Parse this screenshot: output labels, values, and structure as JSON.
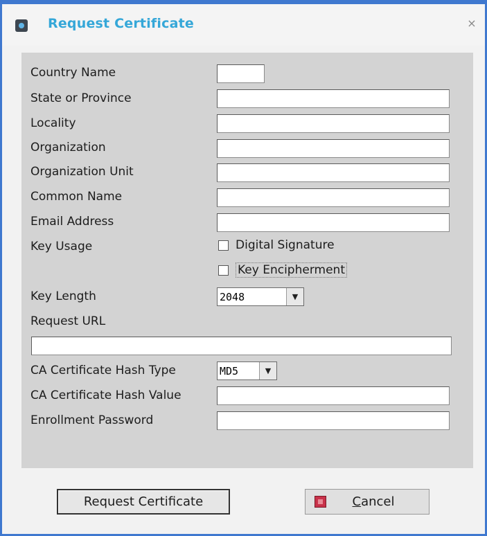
{
  "window": {
    "title": "Request Certificate",
    "close_glyph": "×"
  },
  "fields": [
    {
      "label": "Country Name",
      "value": ""
    },
    {
      "label": "State or Province",
      "value": ""
    },
    {
      "label": "Locality",
      "value": ""
    },
    {
      "label": "Organization",
      "value": ""
    },
    {
      "label": "Organization Unit",
      "value": ""
    },
    {
      "label": "Common Name",
      "value": ""
    },
    {
      "label": "Email Address",
      "value": ""
    }
  ],
  "key_usage": {
    "label": "Key Usage",
    "options": [
      {
        "label": "Digital Signature",
        "checked": false
      },
      {
        "label": "Key Encipherment",
        "checked": false
      }
    ]
  },
  "key_length": {
    "label": "Key Length",
    "value": "2048"
  },
  "request_url": {
    "label": "Request URL",
    "value": ""
  },
  "hash_type": {
    "label": "CA Certificate Hash Type",
    "value": "MD5"
  },
  "hash_value": {
    "label": "CA Certificate Hash Value",
    "value": ""
  },
  "enroll_password": {
    "label": "Enrollment Password",
    "value": ""
  },
  "buttons": {
    "request": "Request Certificate",
    "cancel_first": "C",
    "cancel_rest": "ancel"
  },
  "icons": {
    "app": "certificate-app-icon",
    "cancel": "cancel-red-icon",
    "dropdown": "dropdown-arrow-icon"
  }
}
